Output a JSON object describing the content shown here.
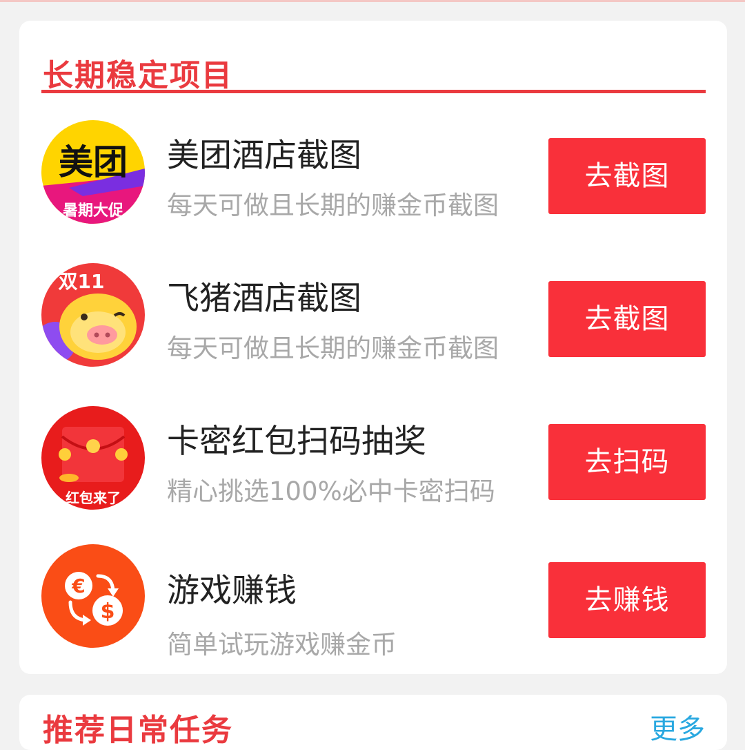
{
  "section": {
    "title": "长期稳定项目"
  },
  "items": [
    {
      "title": "美团酒店截图",
      "desc": "每天可做且长期的赚金币截图",
      "button": "去截图",
      "logo_text": "美团",
      "banner_text": "暑期大促",
      "icon": "meituan-logo"
    },
    {
      "title": "飞猪酒店截图",
      "desc": "每天可做且长期的赚金币截图",
      "button": "去截图",
      "logo_text": "双11",
      "icon": "fliggy-pig-logo"
    },
    {
      "title": "卡密红包扫码抽奖",
      "desc": "精心挑选100%必中卡密扫码",
      "button": "去扫码",
      "logo_text": "红包来了",
      "icon": "red-envelope-logo"
    },
    {
      "title": "游戏赚钱",
      "desc": "简单试玩游戏赚金币",
      "button": "去赚钱",
      "icon": "currency-exchange-icon"
    }
  ],
  "next_section": {
    "title": "推荐日常任务",
    "more": "更多"
  },
  "colors": {
    "accent": "#ea3a3f",
    "button": "#f9303a",
    "title_text": "#222222",
    "desc_text": "#a8a8a8"
  }
}
